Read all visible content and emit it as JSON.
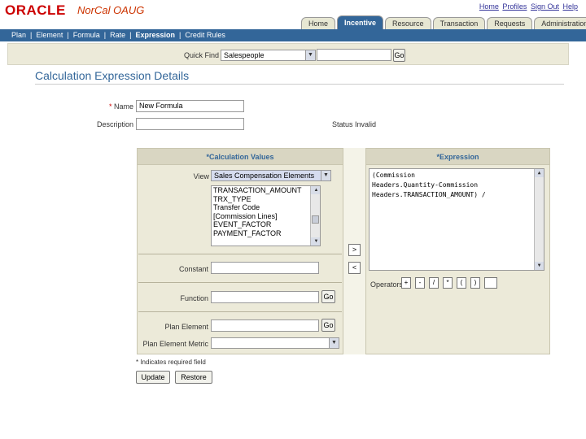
{
  "header": {
    "brand": "ORACLE",
    "subbrand": "NorCal OAUG",
    "global_links": [
      "Home",
      "Profiles",
      "Sign Out",
      "Help"
    ]
  },
  "tabs": [
    "Home",
    "Incentive",
    "Resource",
    "Transaction",
    "Requests",
    "Administration"
  ],
  "active_tab": "Incentive",
  "subnav": [
    "Plan",
    "Element",
    "Formula",
    "Rate",
    "Expression",
    "Credit Rules"
  ],
  "active_subnav": "Expression",
  "quickfind": {
    "label": "Quick Find",
    "select_value": "Salespeople",
    "input_value": "",
    "go_label": "Go"
  },
  "page_title": "Calculation Expression Details",
  "form": {
    "name_label": "Name",
    "name_value": "New Formula",
    "description_label": "Description",
    "description_value": "",
    "status_label": "Status",
    "status_value": "Invalid"
  },
  "calc_values": {
    "header": "*Calculation Values",
    "view_label": "View",
    "view_value": "Sales Compensation Elements",
    "list_items": [
      "TRANSACTION_AMOUNT",
      "TRX_TYPE",
      "Transfer Code",
      "[Commission Lines]",
      "EVENT_FACTOR",
      "PAYMENT_FACTOR"
    ],
    "constant_label": "Constant",
    "constant_value": "",
    "function_label": "Function",
    "function_value": "",
    "plan_element_label": "Plan Element",
    "plan_element_value": "",
    "plan_element_metric_label": "Plan Element Metric",
    "plan_element_metric_value": "",
    "go_label": "Go"
  },
  "expression": {
    "header": "*Expression",
    "lines": [
      "(Commission",
      "Headers.Quantity-Commission",
      "Headers.TRANSACTION_AMOUNT) /"
    ],
    "operators_label": "Operators",
    "operators": [
      "+",
      "-",
      "/",
      "*",
      "(",
      ")",
      ""
    ]
  },
  "move_right": ">",
  "move_left": "<",
  "required_note": "* Indicates required field",
  "buttons": {
    "update": "Update",
    "restore": "Restore"
  },
  "colors": {
    "brand_red": "#cc0000",
    "nav_blue": "#336699",
    "panel_bg": "#ecead9"
  }
}
